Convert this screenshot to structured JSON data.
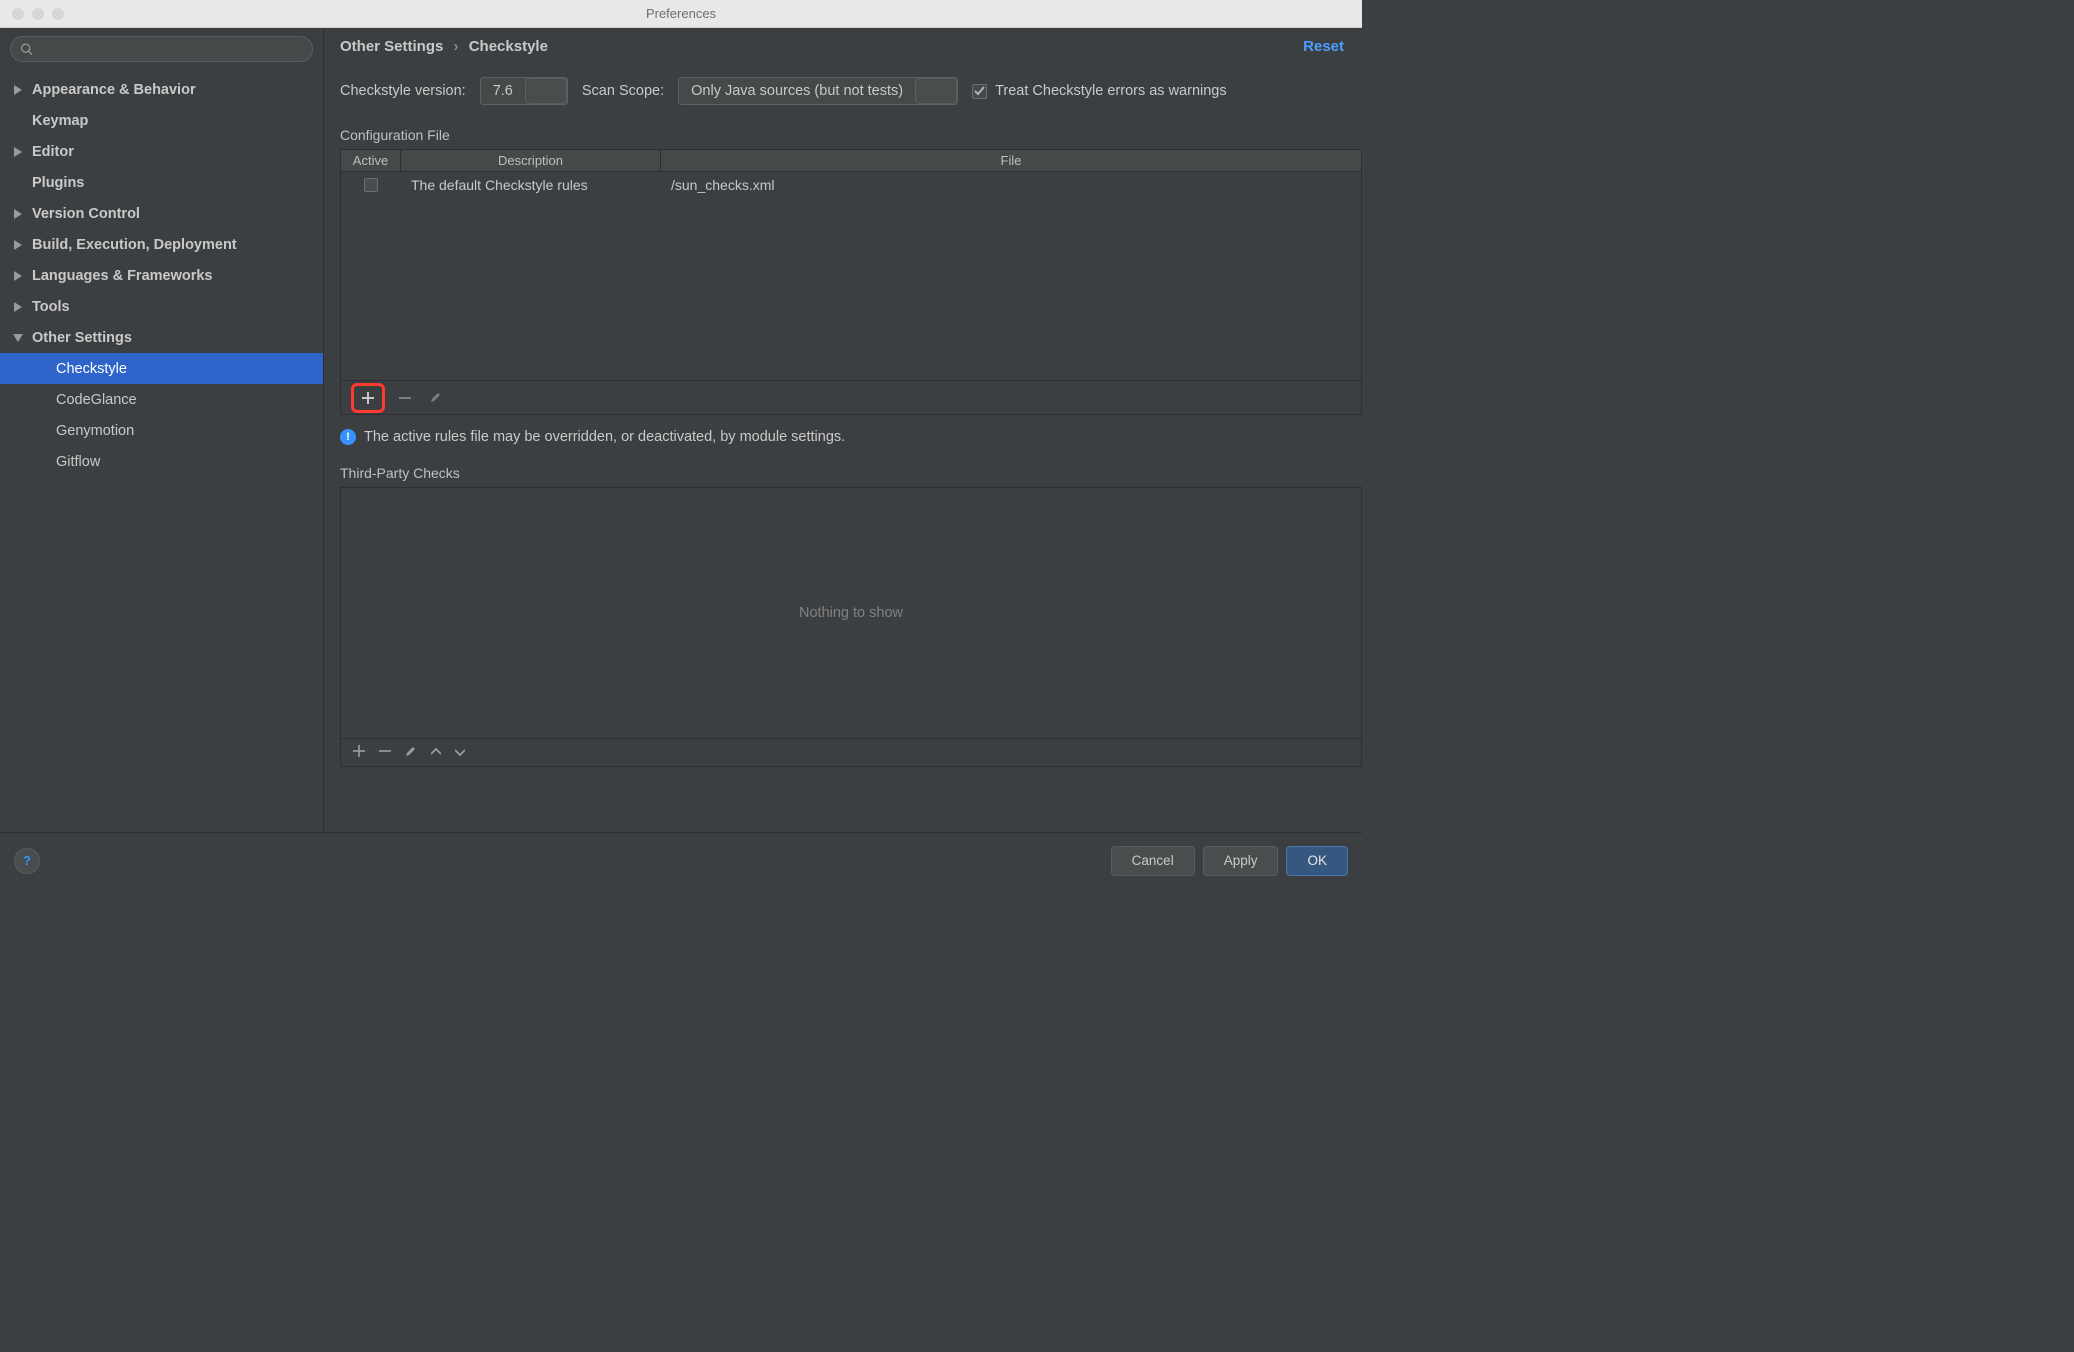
{
  "window": {
    "title": "Preferences"
  },
  "search": {
    "placeholder": ""
  },
  "sidebar": {
    "items": [
      {
        "label": "Appearance & Behavior",
        "expandable": true,
        "expanded": false
      },
      {
        "label": "Keymap",
        "expandable": false
      },
      {
        "label": "Editor",
        "expandable": true,
        "expanded": false
      },
      {
        "label": "Plugins",
        "expandable": false
      },
      {
        "label": "Version Control",
        "expandable": true,
        "expanded": false
      },
      {
        "label": "Build, Execution, Deployment",
        "expandable": true,
        "expanded": false
      },
      {
        "label": "Languages & Frameworks",
        "expandable": true,
        "expanded": false
      },
      {
        "label": "Tools",
        "expandable": true,
        "expanded": false
      },
      {
        "label": "Other Settings",
        "expandable": true,
        "expanded": true,
        "children": [
          {
            "label": "Checkstyle",
            "selected": true
          },
          {
            "label": "CodeGlance"
          },
          {
            "label": "Genymotion"
          },
          {
            "label": "Gitflow"
          }
        ]
      }
    ]
  },
  "breadcrumb": {
    "parent": "Other Settings",
    "current": "Checkstyle",
    "reset": "Reset"
  },
  "form": {
    "version_label": "Checkstyle version:",
    "version_value": "7.6",
    "scope_label": "Scan Scope:",
    "scope_value": "Only Java sources (but not tests)",
    "treat_warnings_label": "Treat Checkstyle errors as warnings",
    "treat_warnings_checked": true
  },
  "config_section": {
    "title": "Configuration File",
    "columns": {
      "active": "Active",
      "description": "Description",
      "file": "File"
    },
    "rows": [
      {
        "active": false,
        "description": "The default Checkstyle rules",
        "file": "/sun_checks.xml"
      }
    ],
    "info": "The active rules file may be overridden, or deactivated, by module settings."
  },
  "third_party": {
    "title": "Third-Party Checks",
    "empty": "Nothing to show"
  },
  "footer": {
    "help": "?",
    "cancel": "Cancel",
    "apply": "Apply",
    "ok": "OK"
  }
}
